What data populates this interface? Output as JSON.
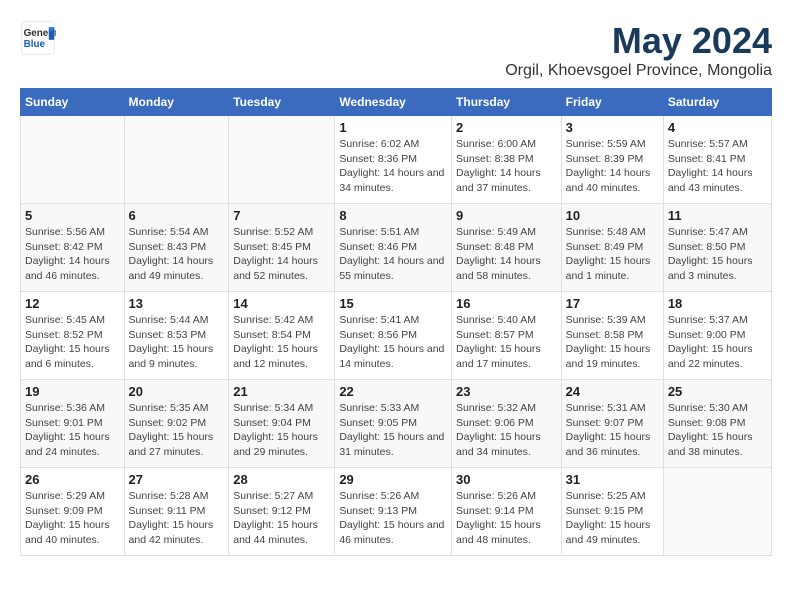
{
  "logo": {
    "general": "General",
    "blue": "Blue"
  },
  "title": "May 2024",
  "subtitle": "Orgil, Khoevsgoel Province, Mongolia",
  "days_of_week": [
    "Sunday",
    "Monday",
    "Tuesday",
    "Wednesday",
    "Thursday",
    "Friday",
    "Saturday"
  ],
  "weeks": [
    [
      {
        "num": "",
        "info": ""
      },
      {
        "num": "",
        "info": ""
      },
      {
        "num": "",
        "info": ""
      },
      {
        "num": "1",
        "info": "Sunrise: 6:02 AM\nSunset: 8:36 PM\nDaylight: 14 hours and 34 minutes."
      },
      {
        "num": "2",
        "info": "Sunrise: 6:00 AM\nSunset: 8:38 PM\nDaylight: 14 hours and 37 minutes."
      },
      {
        "num": "3",
        "info": "Sunrise: 5:59 AM\nSunset: 8:39 PM\nDaylight: 14 hours and 40 minutes."
      },
      {
        "num": "4",
        "info": "Sunrise: 5:57 AM\nSunset: 8:41 PM\nDaylight: 14 hours and 43 minutes."
      }
    ],
    [
      {
        "num": "5",
        "info": "Sunrise: 5:56 AM\nSunset: 8:42 PM\nDaylight: 14 hours and 46 minutes."
      },
      {
        "num": "6",
        "info": "Sunrise: 5:54 AM\nSunset: 8:43 PM\nDaylight: 14 hours and 49 minutes."
      },
      {
        "num": "7",
        "info": "Sunrise: 5:52 AM\nSunset: 8:45 PM\nDaylight: 14 hours and 52 minutes."
      },
      {
        "num": "8",
        "info": "Sunrise: 5:51 AM\nSunset: 8:46 PM\nDaylight: 14 hours and 55 minutes."
      },
      {
        "num": "9",
        "info": "Sunrise: 5:49 AM\nSunset: 8:48 PM\nDaylight: 14 hours and 58 minutes."
      },
      {
        "num": "10",
        "info": "Sunrise: 5:48 AM\nSunset: 8:49 PM\nDaylight: 15 hours and 1 minute."
      },
      {
        "num": "11",
        "info": "Sunrise: 5:47 AM\nSunset: 8:50 PM\nDaylight: 15 hours and 3 minutes."
      }
    ],
    [
      {
        "num": "12",
        "info": "Sunrise: 5:45 AM\nSunset: 8:52 PM\nDaylight: 15 hours and 6 minutes."
      },
      {
        "num": "13",
        "info": "Sunrise: 5:44 AM\nSunset: 8:53 PM\nDaylight: 15 hours and 9 minutes."
      },
      {
        "num": "14",
        "info": "Sunrise: 5:42 AM\nSunset: 8:54 PM\nDaylight: 15 hours and 12 minutes."
      },
      {
        "num": "15",
        "info": "Sunrise: 5:41 AM\nSunset: 8:56 PM\nDaylight: 15 hours and 14 minutes."
      },
      {
        "num": "16",
        "info": "Sunrise: 5:40 AM\nSunset: 8:57 PM\nDaylight: 15 hours and 17 minutes."
      },
      {
        "num": "17",
        "info": "Sunrise: 5:39 AM\nSunset: 8:58 PM\nDaylight: 15 hours and 19 minutes."
      },
      {
        "num": "18",
        "info": "Sunrise: 5:37 AM\nSunset: 9:00 PM\nDaylight: 15 hours and 22 minutes."
      }
    ],
    [
      {
        "num": "19",
        "info": "Sunrise: 5:36 AM\nSunset: 9:01 PM\nDaylight: 15 hours and 24 minutes."
      },
      {
        "num": "20",
        "info": "Sunrise: 5:35 AM\nSunset: 9:02 PM\nDaylight: 15 hours and 27 minutes."
      },
      {
        "num": "21",
        "info": "Sunrise: 5:34 AM\nSunset: 9:04 PM\nDaylight: 15 hours and 29 minutes."
      },
      {
        "num": "22",
        "info": "Sunrise: 5:33 AM\nSunset: 9:05 PM\nDaylight: 15 hours and 31 minutes."
      },
      {
        "num": "23",
        "info": "Sunrise: 5:32 AM\nSunset: 9:06 PM\nDaylight: 15 hours and 34 minutes."
      },
      {
        "num": "24",
        "info": "Sunrise: 5:31 AM\nSunset: 9:07 PM\nDaylight: 15 hours and 36 minutes."
      },
      {
        "num": "25",
        "info": "Sunrise: 5:30 AM\nSunset: 9:08 PM\nDaylight: 15 hours and 38 minutes."
      }
    ],
    [
      {
        "num": "26",
        "info": "Sunrise: 5:29 AM\nSunset: 9:09 PM\nDaylight: 15 hours and 40 minutes."
      },
      {
        "num": "27",
        "info": "Sunrise: 5:28 AM\nSunset: 9:11 PM\nDaylight: 15 hours and 42 minutes."
      },
      {
        "num": "28",
        "info": "Sunrise: 5:27 AM\nSunset: 9:12 PM\nDaylight: 15 hours and 44 minutes."
      },
      {
        "num": "29",
        "info": "Sunrise: 5:26 AM\nSunset: 9:13 PM\nDaylight: 15 hours and 46 minutes."
      },
      {
        "num": "30",
        "info": "Sunrise: 5:26 AM\nSunset: 9:14 PM\nDaylight: 15 hours and 48 minutes."
      },
      {
        "num": "31",
        "info": "Sunrise: 5:25 AM\nSunset: 9:15 PM\nDaylight: 15 hours and 49 minutes."
      },
      {
        "num": "",
        "info": ""
      }
    ]
  ]
}
